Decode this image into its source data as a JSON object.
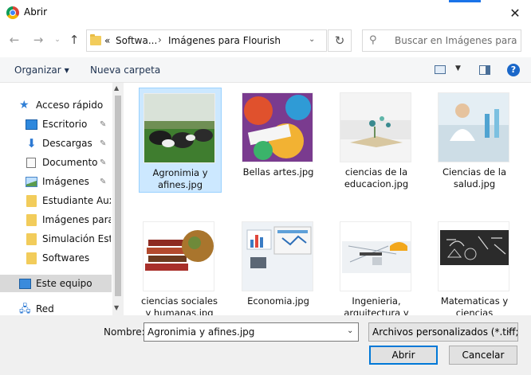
{
  "window": {
    "title": "Abrir",
    "accent_color": "#1a73e8"
  },
  "nav": {
    "breadcrumb": [
      "Softwa...",
      "Imágenes para Flourish"
    ],
    "breadcrumb_prefix": "«",
    "search_placeholder": "Buscar en Imágenes para Flo..."
  },
  "toolbar": {
    "organize": "Organizar",
    "new_folder": "Nueva carpeta"
  },
  "sidebar": {
    "items": [
      {
        "label": "Acceso rápido",
        "icon": "star-icon"
      },
      {
        "label": "Escritorio",
        "icon": "desktop-icon",
        "pinned": true
      },
      {
        "label": "Descargas",
        "icon": "download-icon",
        "pinned": true
      },
      {
        "label": "Documentos",
        "icon": "document-icon",
        "pinned": true
      },
      {
        "label": "Imágenes",
        "icon": "image-icon",
        "pinned": true
      },
      {
        "label": "Estudiante Auxil",
        "icon": "folder-icon"
      },
      {
        "label": "Imágenes para F",
        "icon": "folder-icon"
      },
      {
        "label": "Simulación Estad",
        "icon": "folder-icon"
      },
      {
        "label": "Softwares",
        "icon": "folder-icon"
      },
      {
        "label": "Este equipo",
        "icon": "computer-icon",
        "selected": true
      },
      {
        "label": "Red",
        "icon": "network-icon"
      }
    ]
  },
  "files": [
    {
      "label": "Agronimia y afines.jpg",
      "selected": true
    },
    {
      "label": "Bellas artes.jpg"
    },
    {
      "label": "ciencias de la educacion.jpg"
    },
    {
      "label": "Ciencias de la salud.jpg"
    },
    {
      "label": "ciencias sociales y humanas.jpg"
    },
    {
      "label": "Economia.jpg"
    },
    {
      "label": "Ingenieria, arquitectura y urbanismo.jpg"
    },
    {
      "label": "Matematicas y ciencias naturales.jpg"
    }
  ],
  "footer": {
    "filename_label": "Nombre:",
    "filename_value": "Agronimia y afines.jpg",
    "filter_value": "Archivos personalizados (*.tiff;*",
    "open_label": "Abrir",
    "cancel_label": "Cancelar"
  }
}
